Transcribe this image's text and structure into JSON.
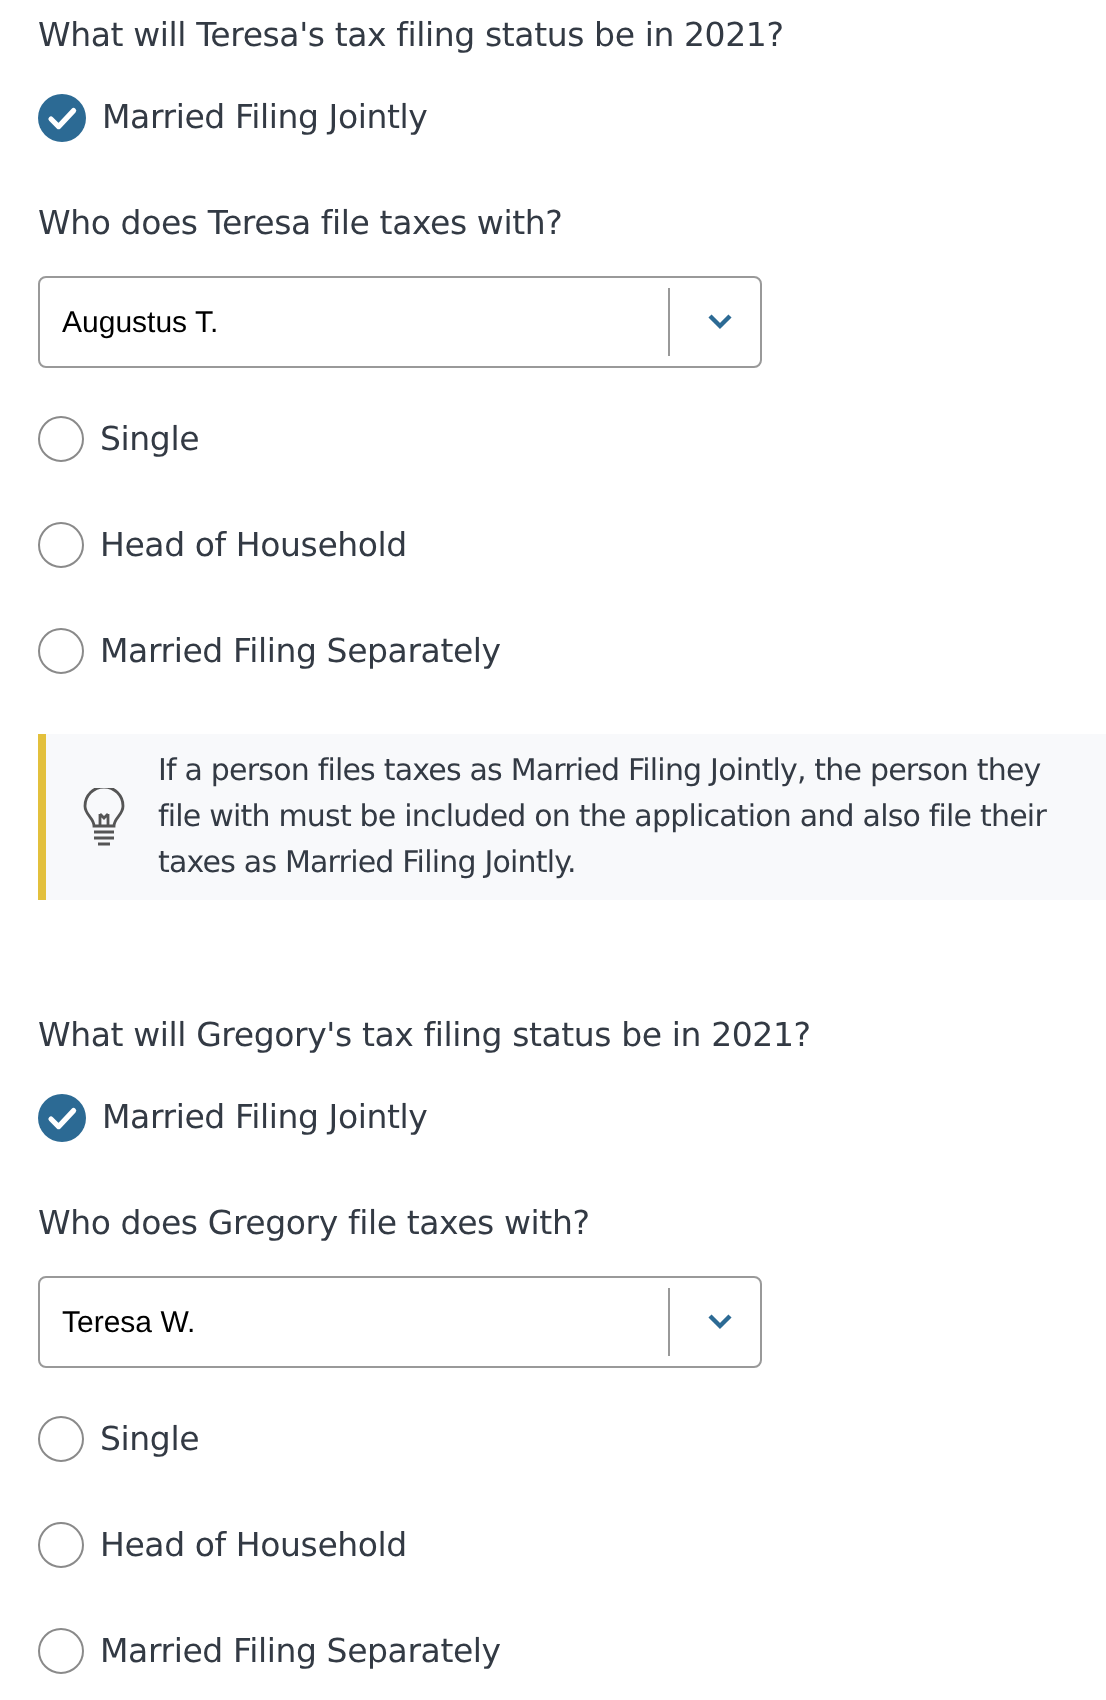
{
  "sections": [
    {
      "question": "What will Teresa's tax filing status be in 2021?",
      "checkbox": {
        "label": "Married Filing Jointly",
        "checked": true
      },
      "partner_question": "Who does Teresa file taxes with?",
      "select": {
        "value": "Augustus T."
      },
      "radios": [
        {
          "label": "Single",
          "selected": false
        },
        {
          "label": "Head of Household",
          "selected": false
        },
        {
          "label": "Married Filing Separately",
          "selected": false
        }
      ],
      "tip": {
        "text": "If a person files taxes as Married Filing Jointly, the person they file with must be included on the application and also file their taxes as Married Filing Jointly."
      }
    },
    {
      "question": "What will Gregory's tax filing status be in 2021?",
      "checkbox": {
        "label": "Married Filing Jointly",
        "checked": true
      },
      "partner_question": "Who does Gregory file taxes with?",
      "select": {
        "value": "Teresa W."
      },
      "radios": [
        {
          "label": "Single",
          "selected": false
        },
        {
          "label": "Head of Household",
          "selected": false
        },
        {
          "label": "Married Filing Separately",
          "selected": false
        }
      ]
    }
  ]
}
